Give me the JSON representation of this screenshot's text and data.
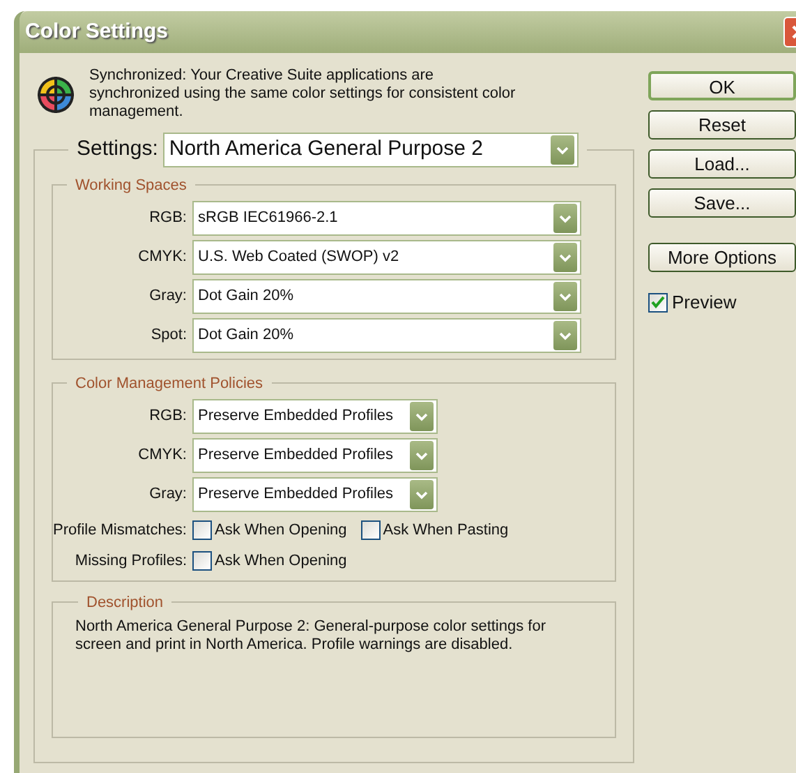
{
  "window": {
    "title": "Color Settings"
  },
  "sync_message": "Synchronized: Your Creative Suite applications are synchronized using the same color settings for consistent color management.",
  "settings": {
    "label": "Settings:",
    "value": "North America General Purpose 2"
  },
  "working_spaces": {
    "title": "Working Spaces",
    "rows": [
      {
        "label": "RGB:",
        "value": "sRGB IEC61966-2.1"
      },
      {
        "label": "CMYK:",
        "value": "U.S. Web Coated (SWOP) v2"
      },
      {
        "label": "Gray:",
        "value": "Dot Gain 20%"
      },
      {
        "label": "Spot:",
        "value": "Dot Gain 20%"
      }
    ]
  },
  "policies": {
    "title": "Color Management Policies",
    "rows": [
      {
        "label": "RGB:",
        "value": "Preserve Embedded Profiles"
      },
      {
        "label": "CMYK:",
        "value": "Preserve Embedded Profiles"
      },
      {
        "label": "Gray:",
        "value": "Preserve Embedded Profiles"
      }
    ],
    "checks": [
      {
        "label": "Profile Mismatches:",
        "options": [
          {
            "label": "Ask When Opening",
            "checked": false
          },
          {
            "label": "Ask When Pasting",
            "checked": false
          }
        ]
      },
      {
        "label": "Missing Profiles:",
        "options": [
          {
            "label": "Ask When Opening",
            "checked": false
          }
        ]
      }
    ]
  },
  "description": {
    "title": "Description",
    "text": "North America General Purpose 2:  General-purpose color settings for screen and print in North America. Profile warnings are disabled."
  },
  "buttons": [
    {
      "label": "OK",
      "default": true
    },
    {
      "label": "Reset",
      "default": false
    },
    {
      "label": "Load...",
      "default": false
    },
    {
      "label": "Save...",
      "default": false
    },
    {
      "label": "More Options",
      "default": false
    }
  ],
  "preview": {
    "label": "Preview",
    "checked": true
  }
}
